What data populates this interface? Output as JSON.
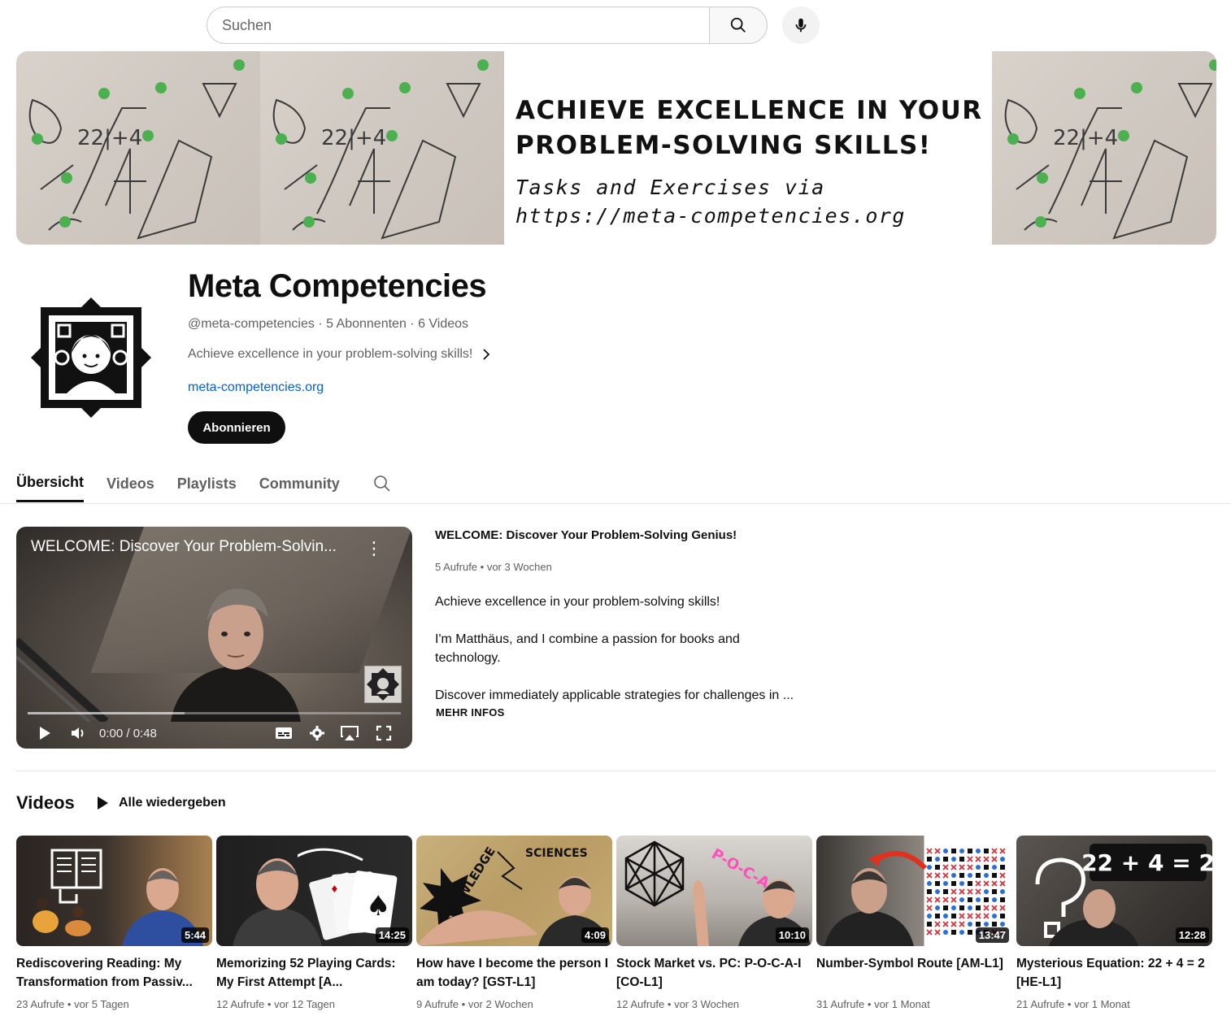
{
  "search": {
    "placeholder": "Suchen"
  },
  "banner": {
    "headline_line1": "ACHIEVE EXCELLENCE IN YOUR",
    "headline_line2": "PROBLEM-SOLVING SKILLS!",
    "sub_line1": "Tasks and Exercises via",
    "sub_line2": "https://meta-competencies.org"
  },
  "channel": {
    "name": "Meta Competencies",
    "handle": "@meta-competencies",
    "subscribers": "5 Abonnenten",
    "videos_count": "6 Videos",
    "description": "Achieve excellence in your problem-solving skills!",
    "link": "meta-competencies.org",
    "subscribe_label": "Abonnieren"
  },
  "tabs": [
    "Übersicht",
    "Videos",
    "Playlists",
    "Community"
  ],
  "featured": {
    "player_title": "WELCOME: Discover Your Problem-Solvin...",
    "time": "0:00 / 0:48",
    "buffered_fraction": 0.42,
    "title": "WELCOME: Discover Your Problem-Solving Genius!",
    "views": "5 Aufrufe",
    "age": "vor 3 Wochen",
    "desc_p1": "Achieve excellence in your problem-solving skills!",
    "desc_p2": "I'm Matthäus, and I combine a passion for books and technology.",
    "desc_p3": "Discover immediately applicable strategies for challenges in ...",
    "more_label": "MEHR INFOS"
  },
  "videos_section": {
    "heading": "Videos",
    "play_all": "Alle wiedergeben",
    "items": [
      {
        "title": "Rediscovering Reading: My Transformation from Passiv...",
        "duration": "5:44",
        "views": "23 Aufrufe",
        "age": "vor 5 Tagen"
      },
      {
        "title": "Memorizing 52 Playing Cards: My First Attempt [A...",
        "duration": "14:25",
        "views": "12 Aufrufe",
        "age": "vor 12 Tagen"
      },
      {
        "title": "How have I become the person I am today? [GST-L1]",
        "duration": "4:09",
        "views": "9 Aufrufe",
        "age": "vor 2 Wochen"
      },
      {
        "title": "Stock Market vs. PC: P-O-C-A-I [CO-L1]",
        "duration": "10:10",
        "views": "12 Aufrufe",
        "age": "vor 3 Wochen"
      },
      {
        "title": "Number-Symbol Route [AM-L1]",
        "duration": "13:47",
        "views": "31 Aufrufe",
        "age": "vor 1 Monat"
      },
      {
        "title": "Mysterious Equation: 22 + 4 = 2 [HE-L1]",
        "duration": "12:28",
        "views": "21 Aufrufe",
        "age": "vor 1 Monat"
      }
    ]
  },
  "thumb_text": {
    "knowledge": "KNOWLEDGE",
    "sciences": "SCIENCES",
    "poca": "P-O-C-A-I",
    "equation": "22 + 4 = 2"
  },
  "colors": {
    "link": "#065fd4",
    "accent": "#0f0f0f",
    "progress": "#ff0000"
  }
}
